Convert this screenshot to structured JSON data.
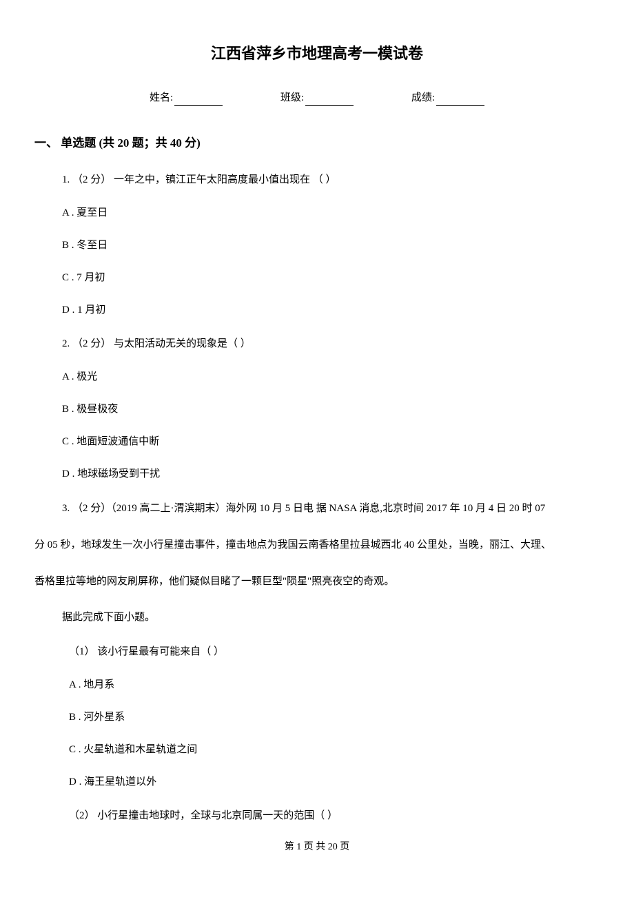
{
  "title": "江西省萍乡市地理高考一模试卷",
  "info": {
    "name_label": "姓名:",
    "class_label": "班级:",
    "score_label": "成绩:"
  },
  "section_header": "一、 单选题 (共 20 题；共 40 分)",
  "q1": {
    "stem": "1. （2 分） 一年之中，镇江正午太阳高度最小值出现在  （    ）",
    "a": "A . 夏至日",
    "b": "B . 冬至日",
    "c": "C . 7 月初",
    "d": "D . 1 月初"
  },
  "q2": {
    "stem": "2. （2 分） 与太阳活动无关的现象是（    ）",
    "a": "A . 极光",
    "b": "B . 极昼极夜",
    "c": "C . 地面短波通信中断",
    "d": "D . 地球磁场受到干扰"
  },
  "q3": {
    "stem_line1": "3. （2 分）（2019 高二上·渭滨期末）海外网 10 月 5 日电 据 NASA 消息,北京时间 2017 年 10 月 4 日 20 时 07",
    "stem_line2": "分 05 秒，地球发生一次小行星撞击事件，撞击地点为我国云南香格里拉县城西北 40 公里处，当晚，丽江、大理、",
    "stem_line3": "香格里拉等地的网友刷屏称，他们疑似目睹了一颗巨型\"陨星\"照亮夜空的奇观。",
    "instruction": "据此完成下面小题。",
    "sub1": {
      "stem": "（1） 该小行星最有可能来自（    ）",
      "a": "A . 地月系",
      "b": "B . 河外星系",
      "c": "C . 火星轨道和木星轨道之间",
      "d": "D . 海王星轨道以外"
    },
    "sub2": {
      "stem": "（2） 小行星撞击地球时，全球与北京同属一天的范围（    ）"
    }
  },
  "footer": "第 1 页 共 20 页"
}
